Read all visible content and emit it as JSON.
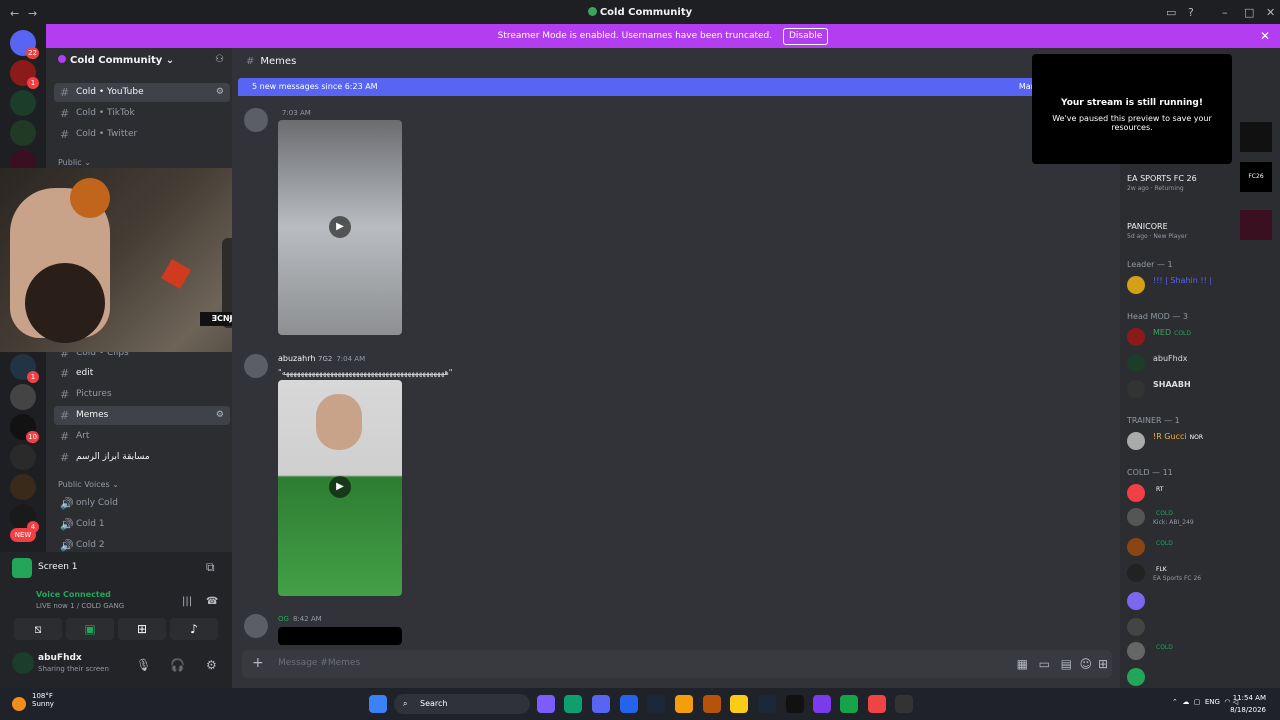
{
  "window": {
    "title": "Cold Community"
  },
  "banner": {
    "text": "Streamer Mode is enabled. Usernames have been truncated.",
    "disable_label": "Disable"
  },
  "server_rail": {
    "servers": [
      {
        "icon": "discord-home-icon",
        "badge": "22"
      },
      {
        "icon": "server-icon",
        "badge": "1"
      },
      {
        "icon": "server-icon",
        "badge": ""
      },
      {
        "icon": "server-icon",
        "badge": ""
      },
      {
        "icon": "server-icon",
        "badge": ""
      },
      {
        "icon": "server-icon",
        "badge": "1"
      },
      {
        "icon": "server-icon",
        "badge": ""
      },
      {
        "icon": "server-icon",
        "badge": "10"
      },
      {
        "icon": "server-icon",
        "badge": ""
      },
      {
        "icon": "server-icon",
        "badge": ""
      },
      {
        "icon": "server-icon",
        "badge": "4"
      },
      {
        "icon": "new-icon",
        "badge": "NEW"
      }
    ]
  },
  "sidebar": {
    "server_name": "Cold Community",
    "channels_top": [
      {
        "name": "Cold • YouTube",
        "active": false
      },
      {
        "name": "Cold • TikTok",
        "active": false
      },
      {
        "name": "Cold • Twitter",
        "active": false
      }
    ],
    "category_public": "Public",
    "channels_lower": [
      {
        "name": "Cold • Clips",
        "active": false
      },
      {
        "name": "edit",
        "active": false
      },
      {
        "name": "Pictures",
        "active": false
      },
      {
        "name": "Memes",
        "active": true
      },
      {
        "name": "Art",
        "active": false
      },
      {
        "name": "مسابقة ابراز الرسم",
        "active": false
      }
    ],
    "category_voice": "Public Voices",
    "voice_channels": [
      "only Cold",
      "Cold 1",
      "Cold 2"
    ]
  },
  "webcam": {
    "tag": "ƎCNɈ"
  },
  "user_panel": {
    "screen_label": "Screen 1",
    "voice_status": "Voice Connected",
    "voice_channel": "LIVE now 1 / COLD GANG",
    "username": "abuFhdx",
    "user_status": "Sharing their screen"
  },
  "chat": {
    "channel_name": "Memes",
    "new_messages": "5 new messages since 6:23 AM",
    "mark_read": "Mar",
    "messages": [
      {
        "author": "",
        "time": "7:03 AM",
        "text": ""
      },
      {
        "author": "abuzahrh",
        "role": "7G2",
        "time": "7:04 AM",
        "text": "\"ههههههههههههههههههههههههههههههههههههههههههههه\""
      },
      {
        "author": "",
        "role": "OG",
        "time": "8:42 AM",
        "text": ""
      }
    ],
    "composer_placeholder": "Message #Memes"
  },
  "popup": {
    "title": "Your stream is still running!",
    "subtitle": "We've paused this preview to save your resources."
  },
  "members": {
    "activities": [
      {
        "name": "EA SPORTS FC 26",
        "sub": "2w ago · Returning"
      },
      {
        "name": "PANICORE",
        "sub": "5d ago · New Player"
      }
    ],
    "groups": [
      {
        "label": "Leader — 1",
        "members": [
          {
            "name": "!!! | Shahin !! | ",
            "tag": ""
          }
        ]
      },
      {
        "label": "Head MOD — 3",
        "members": [
          {
            "name": "MED",
            "tag": "COLD"
          },
          {
            "name": "abuFhdx",
            "tag": ""
          },
          {
            "name": "SHAABH",
            "tag": ""
          }
        ]
      },
      {
        "label": "TRAINER — 1",
        "members": [
          {
            "name": "!R Gucci",
            "tag": "NOR"
          }
        ]
      },
      {
        "label": "COLD — 11",
        "members": [
          {
            "name": "",
            "tag": "RT"
          },
          {
            "name": "",
            "tag": "COLD",
            "sub": "Kick: ABI_249"
          },
          {
            "name": "",
            "tag": "COLD"
          },
          {
            "name": "",
            "tag": "FLK",
            "sub": "EA Sports FC 26"
          },
          {
            "name": "",
            "tag": ""
          },
          {
            "name": "",
            "tag": ""
          },
          {
            "name": "",
            "tag": "COLD"
          },
          {
            "name": "",
            "tag": ""
          }
        ]
      }
    ]
  },
  "taskbar": {
    "weather_temp": "108°F",
    "weather_desc": "Sunny",
    "search_label": "Search",
    "lang": "ENG",
    "time": "11:54 AM",
    "date": "8/18/2026"
  },
  "colors": {
    "accent": "#b33df0",
    "discord_blue": "#5865f2",
    "online": "#23a55a"
  }
}
